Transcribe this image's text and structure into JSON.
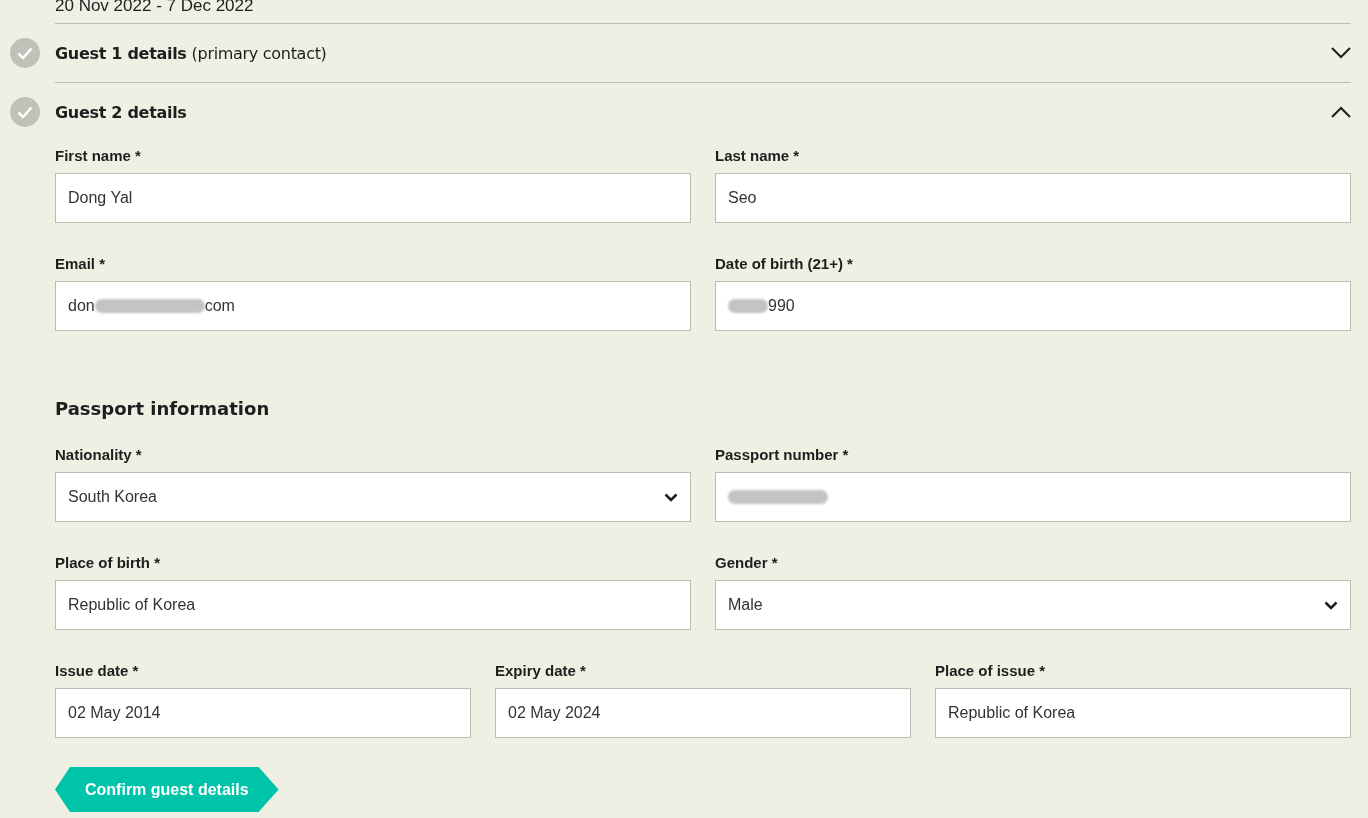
{
  "dates": "20 Nov 2022 - 7 Dec 2022",
  "sections": [
    {
      "title": "Guest 1 details",
      "subtitle": "(primary contact)",
      "completed": true,
      "expanded": false
    },
    {
      "title": "Guest 2 details",
      "completed": true,
      "expanded": true
    }
  ],
  "rows": [
    [
      {
        "label": "First name *",
        "kind": "text",
        "value": "Dong Yal"
      },
      {
        "label": "Last name *",
        "kind": "text",
        "value": "Seo"
      }
    ],
    [
      {
        "label": "Email *",
        "kind": "text",
        "value_start": "don",
        "value_end": "com",
        "redacted": true
      },
      {
        "label": "Date of birth (21+) *",
        "kind": "text",
        "value_end": "990",
        "redacted": true
      }
    ]
  ],
  "passport": {
    "heading": "Passport information",
    "rows": [
      [
        {
          "label": "Nationality *",
          "kind": "select",
          "value": "South Korea"
        },
        {
          "label": "Passport number *",
          "kind": "text",
          "redacted": true
        }
      ],
      [
        {
          "label": "Place of birth *",
          "kind": "text",
          "value": "Republic of Korea"
        },
        {
          "label": "Gender *",
          "kind": "select",
          "value": "Male"
        }
      ],
      [
        {
          "label": "Issue date *",
          "kind": "text",
          "value": "02 May 2014"
        },
        {
          "label": "Expiry date *",
          "kind": "text",
          "value": "02 May 2024"
        },
        {
          "label": "Place of issue *",
          "kind": "text",
          "value": "Republic of Korea"
        }
      ]
    ]
  },
  "confirm_button": "Confirm guest details"
}
